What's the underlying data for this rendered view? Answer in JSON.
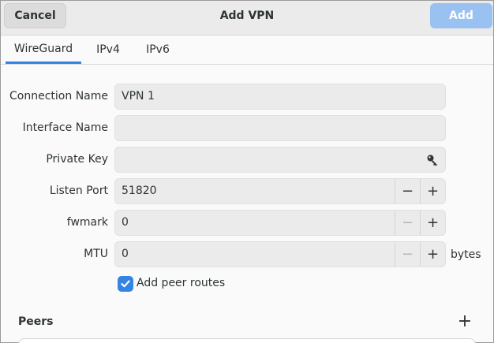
{
  "header": {
    "cancel_label": "Cancel",
    "title": "Add VPN",
    "add_label": "Add"
  },
  "tabs": [
    {
      "label": "WireGuard",
      "active": true
    },
    {
      "label": "IPv4",
      "active": false
    },
    {
      "label": "IPv6",
      "active": false
    }
  ],
  "form": {
    "connection_name": {
      "label": "Connection Name",
      "value": "VPN 1"
    },
    "interface_name": {
      "label": "Interface Name",
      "value": ""
    },
    "private_key": {
      "label": "Private Key",
      "value": "",
      "icon": "key-icon"
    },
    "listen_port": {
      "label": "Listen Port",
      "value": "51820",
      "minus_enabled": true
    },
    "fwmark": {
      "label": "fwmark",
      "value": "0",
      "minus_enabled": false
    },
    "mtu": {
      "label": "MTU",
      "value": "0",
      "minus_enabled": false,
      "unit": "bytes"
    },
    "add_peer_routes": {
      "label": "Add peer routes",
      "checked": true
    }
  },
  "peers": {
    "title": "Peers",
    "add_icon": "plus-icon"
  },
  "colors": {
    "accent": "#3584e4",
    "add_button_disabled": "#99c1f1"
  },
  "glyphs": {
    "minus": "−",
    "plus": "+"
  }
}
